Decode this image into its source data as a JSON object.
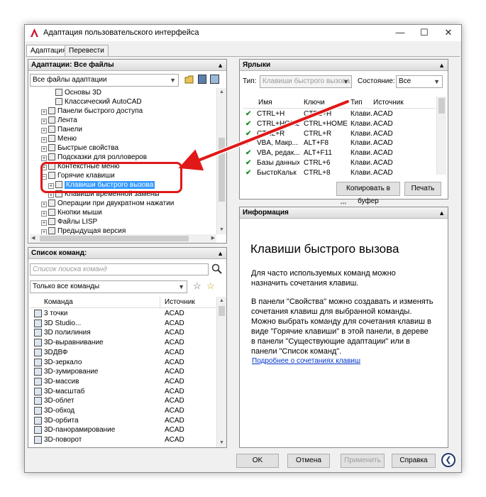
{
  "window": {
    "title": "Адаптация пользовательского интерфейса",
    "tabs": [
      "Адаптация",
      "Перевести"
    ]
  },
  "customizations": {
    "header": "Адаптации: Все файлы",
    "file_filter": "Все файлы адаптации",
    "tree": [
      {
        "label": "Основы 3D",
        "indent": 3
      },
      {
        "label": "Классический AutoCAD",
        "indent": 3
      },
      {
        "label": "Панели быстрого доступа",
        "indent": 1
      },
      {
        "label": "Лента",
        "indent": 1
      },
      {
        "label": "Панели",
        "indent": 1
      },
      {
        "label": "Меню",
        "indent": 1
      },
      {
        "label": "Быстрые свойства",
        "indent": 1
      },
      {
        "label": "Подсказки для ролловеров",
        "indent": 1
      },
      {
        "label": "Контекстные меню",
        "indent": 1
      },
      {
        "label": "Горячие клавиши",
        "indent": 1
      },
      {
        "label": "Клавиши быстрого вызова",
        "indent": 2
      },
      {
        "label": "Клавиши временной замены",
        "indent": 2
      },
      {
        "label": "Операции при двукратном нажатии",
        "indent": 1
      },
      {
        "label": "Кнопки мыши",
        "indent": 1
      },
      {
        "label": "Файлы LISP",
        "indent": 1
      },
      {
        "label": "Предыдущая версия",
        "indent": 1
      }
    ]
  },
  "commands": {
    "header": "Список команд:",
    "search_placeholder": "Список поиска команд",
    "filter": "Только все команды",
    "col_command": "Команда",
    "col_source": "Источник",
    "rows": [
      {
        "name": "3 точки",
        "source": "ACAD"
      },
      {
        "name": "3D Studio...",
        "source": "ACAD"
      },
      {
        "name": "3D полилиния",
        "source": "ACAD"
      },
      {
        "name": "3D-выравнивание",
        "source": "ACAD"
      },
      {
        "name": "3DДВФ",
        "source": "ACAD"
      },
      {
        "name": "3D-зеркало",
        "source": "ACAD"
      },
      {
        "name": "3D-зумирование",
        "source": "ACAD"
      },
      {
        "name": "3D-массив",
        "source": "ACAD"
      },
      {
        "name": "3D-масштаб",
        "source": "ACAD"
      },
      {
        "name": "3D-облет",
        "source": "ACAD"
      },
      {
        "name": "3D-обход",
        "source": "ACAD"
      },
      {
        "name": "3D-орбита",
        "source": "ACAD"
      },
      {
        "name": "3D-панорамирование",
        "source": "ACAD"
      },
      {
        "name": "3D-поворот",
        "source": "ACAD"
      }
    ]
  },
  "shortcuts": {
    "header": "Ярлыки",
    "type_label": "Тип:",
    "type_value": "Клавиши быстрого вызова",
    "state_label": "Состояние:",
    "state_value": "Все",
    "columns": [
      "Имя",
      "Ключи",
      "Тип",
      "Источник"
    ],
    "rows": [
      {
        "name": "CTRL+H",
        "keys": "CTRL+H",
        "type": "Клави...",
        "source": "ACAD"
      },
      {
        "name": "CTRL+HOME",
        "keys": "CTRL+HOME",
        "type": "Клави...",
        "source": "ACAD"
      },
      {
        "name": "CTRL+R",
        "keys": "CTRL+R",
        "type": "Клави...",
        "source": "ACAD"
      },
      {
        "name": "VBA, Макр...",
        "keys": "ALT+F8",
        "type": "Клави...",
        "source": "ACAD"
      },
      {
        "name": "VBA, редак...",
        "keys": "ALT+F11",
        "type": "Клави...",
        "source": "ACAD"
      },
      {
        "name": "Базы данных",
        "keys": "CTRL+6",
        "type": "Клави...",
        "source": "ACAD"
      },
      {
        "name": "БыстрКальк",
        "keys": "CTRL+8",
        "type": "Клави...",
        "source": "ACAD"
      }
    ],
    "copy_button": "Копировать в буфер",
    "print_button": "Печать"
  },
  "info": {
    "header": "Информация",
    "title": "Клавиши быстрого вызова",
    "para1": "Для часто используемых команд можно назначить сочетания клавиш.",
    "para2": "В панели \"Свойства\" можно создавать и изменять сочетания клавиш для выбранной команды. Можно выбрать команду для сочетания клавиш в виде \"Горячие клавиши\" в этой панели, в дереве в панели \"Существующие адаптации\" или в панели \"Список команд\".",
    "link": "Подробнее о сочетаниях клавиш"
  },
  "footer": {
    "ok": "OK",
    "cancel": "Отмена",
    "apply": "Применить",
    "help": "Справка"
  },
  "colors": {
    "selection": "#3399ff",
    "highlight_box": "#e01818",
    "arrow": "#e01818",
    "check": "#1a8f2a"
  }
}
